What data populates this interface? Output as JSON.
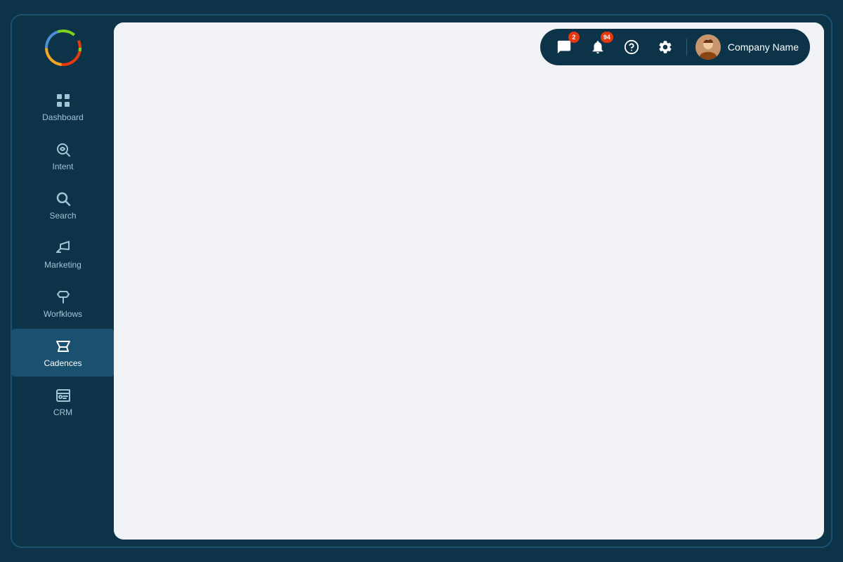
{
  "app": {
    "logo_alt": "App Logo"
  },
  "sidebar": {
    "items": [
      {
        "id": "dashboard",
        "label": "Dashboard",
        "active": false
      },
      {
        "id": "intent",
        "label": "Intent",
        "active": false
      },
      {
        "id": "search",
        "label": "Search",
        "active": false
      },
      {
        "id": "marketing",
        "label": "Marketing",
        "active": false
      },
      {
        "id": "workflows",
        "label": "Worfklows",
        "active": false
      },
      {
        "id": "cadences",
        "label": "Cadences",
        "active": true
      },
      {
        "id": "crm",
        "label": "CRM",
        "active": false
      }
    ]
  },
  "header": {
    "messages_badge": "2",
    "notifications_badge": "94",
    "company_name": "Company Name"
  }
}
